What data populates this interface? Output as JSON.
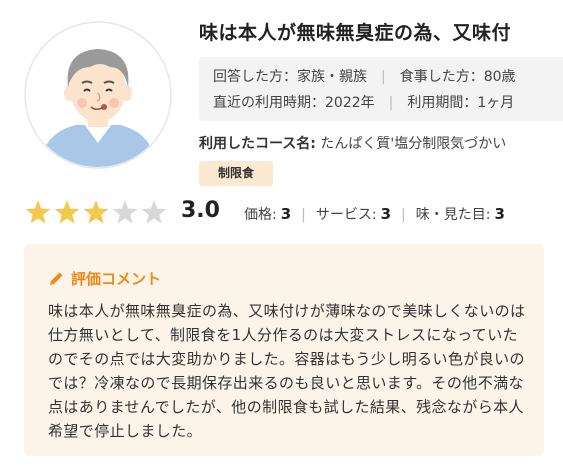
{
  "review": {
    "title": "味は本人が無味無臭症の為、又味付",
    "meta": {
      "respondent": "回答した方：家族・親族",
      "eater": "食事した方：80歳",
      "last_used": "直近の利用時期：2022年",
      "period": "利用期間：1ヶ月"
    },
    "course_label": "利用したコース名:",
    "course_value": "たんぱく質'塩分制限気づかい",
    "tag": "制限食",
    "rating": {
      "value": 3,
      "max": 5,
      "score_text": "3.0",
      "price_label": "価格:",
      "price": "3",
      "service_label": "サービス:",
      "service": "3",
      "taste_label": "味・見た目:",
      "taste": "3"
    },
    "comment_title": "評価コメント",
    "comment": "味は本人が無味無臭症の為、又味付けが薄味なので美味しくないのは仕方無いとして、制限食を1人分作るのは大変ストレスになっていたのでその点では大変助かりました。容器はもう少し明るい色が良いのでは？冷凍なので長期保存出来るのも良いと思います。その他不満な点はありませんでしたが、他の制限食も試した結果、残念ながら本人希望で停止しました。"
  },
  "colors": {
    "accent": "#ee8a16",
    "star_on": "#f4c84a",
    "star_off": "#d8d8d8",
    "comment_bg": "#fdf4e9",
    "tag_bg": "#fbe9d2"
  },
  "icons": [
    "user-avatar",
    "star-icon",
    "pencil-icon"
  ]
}
